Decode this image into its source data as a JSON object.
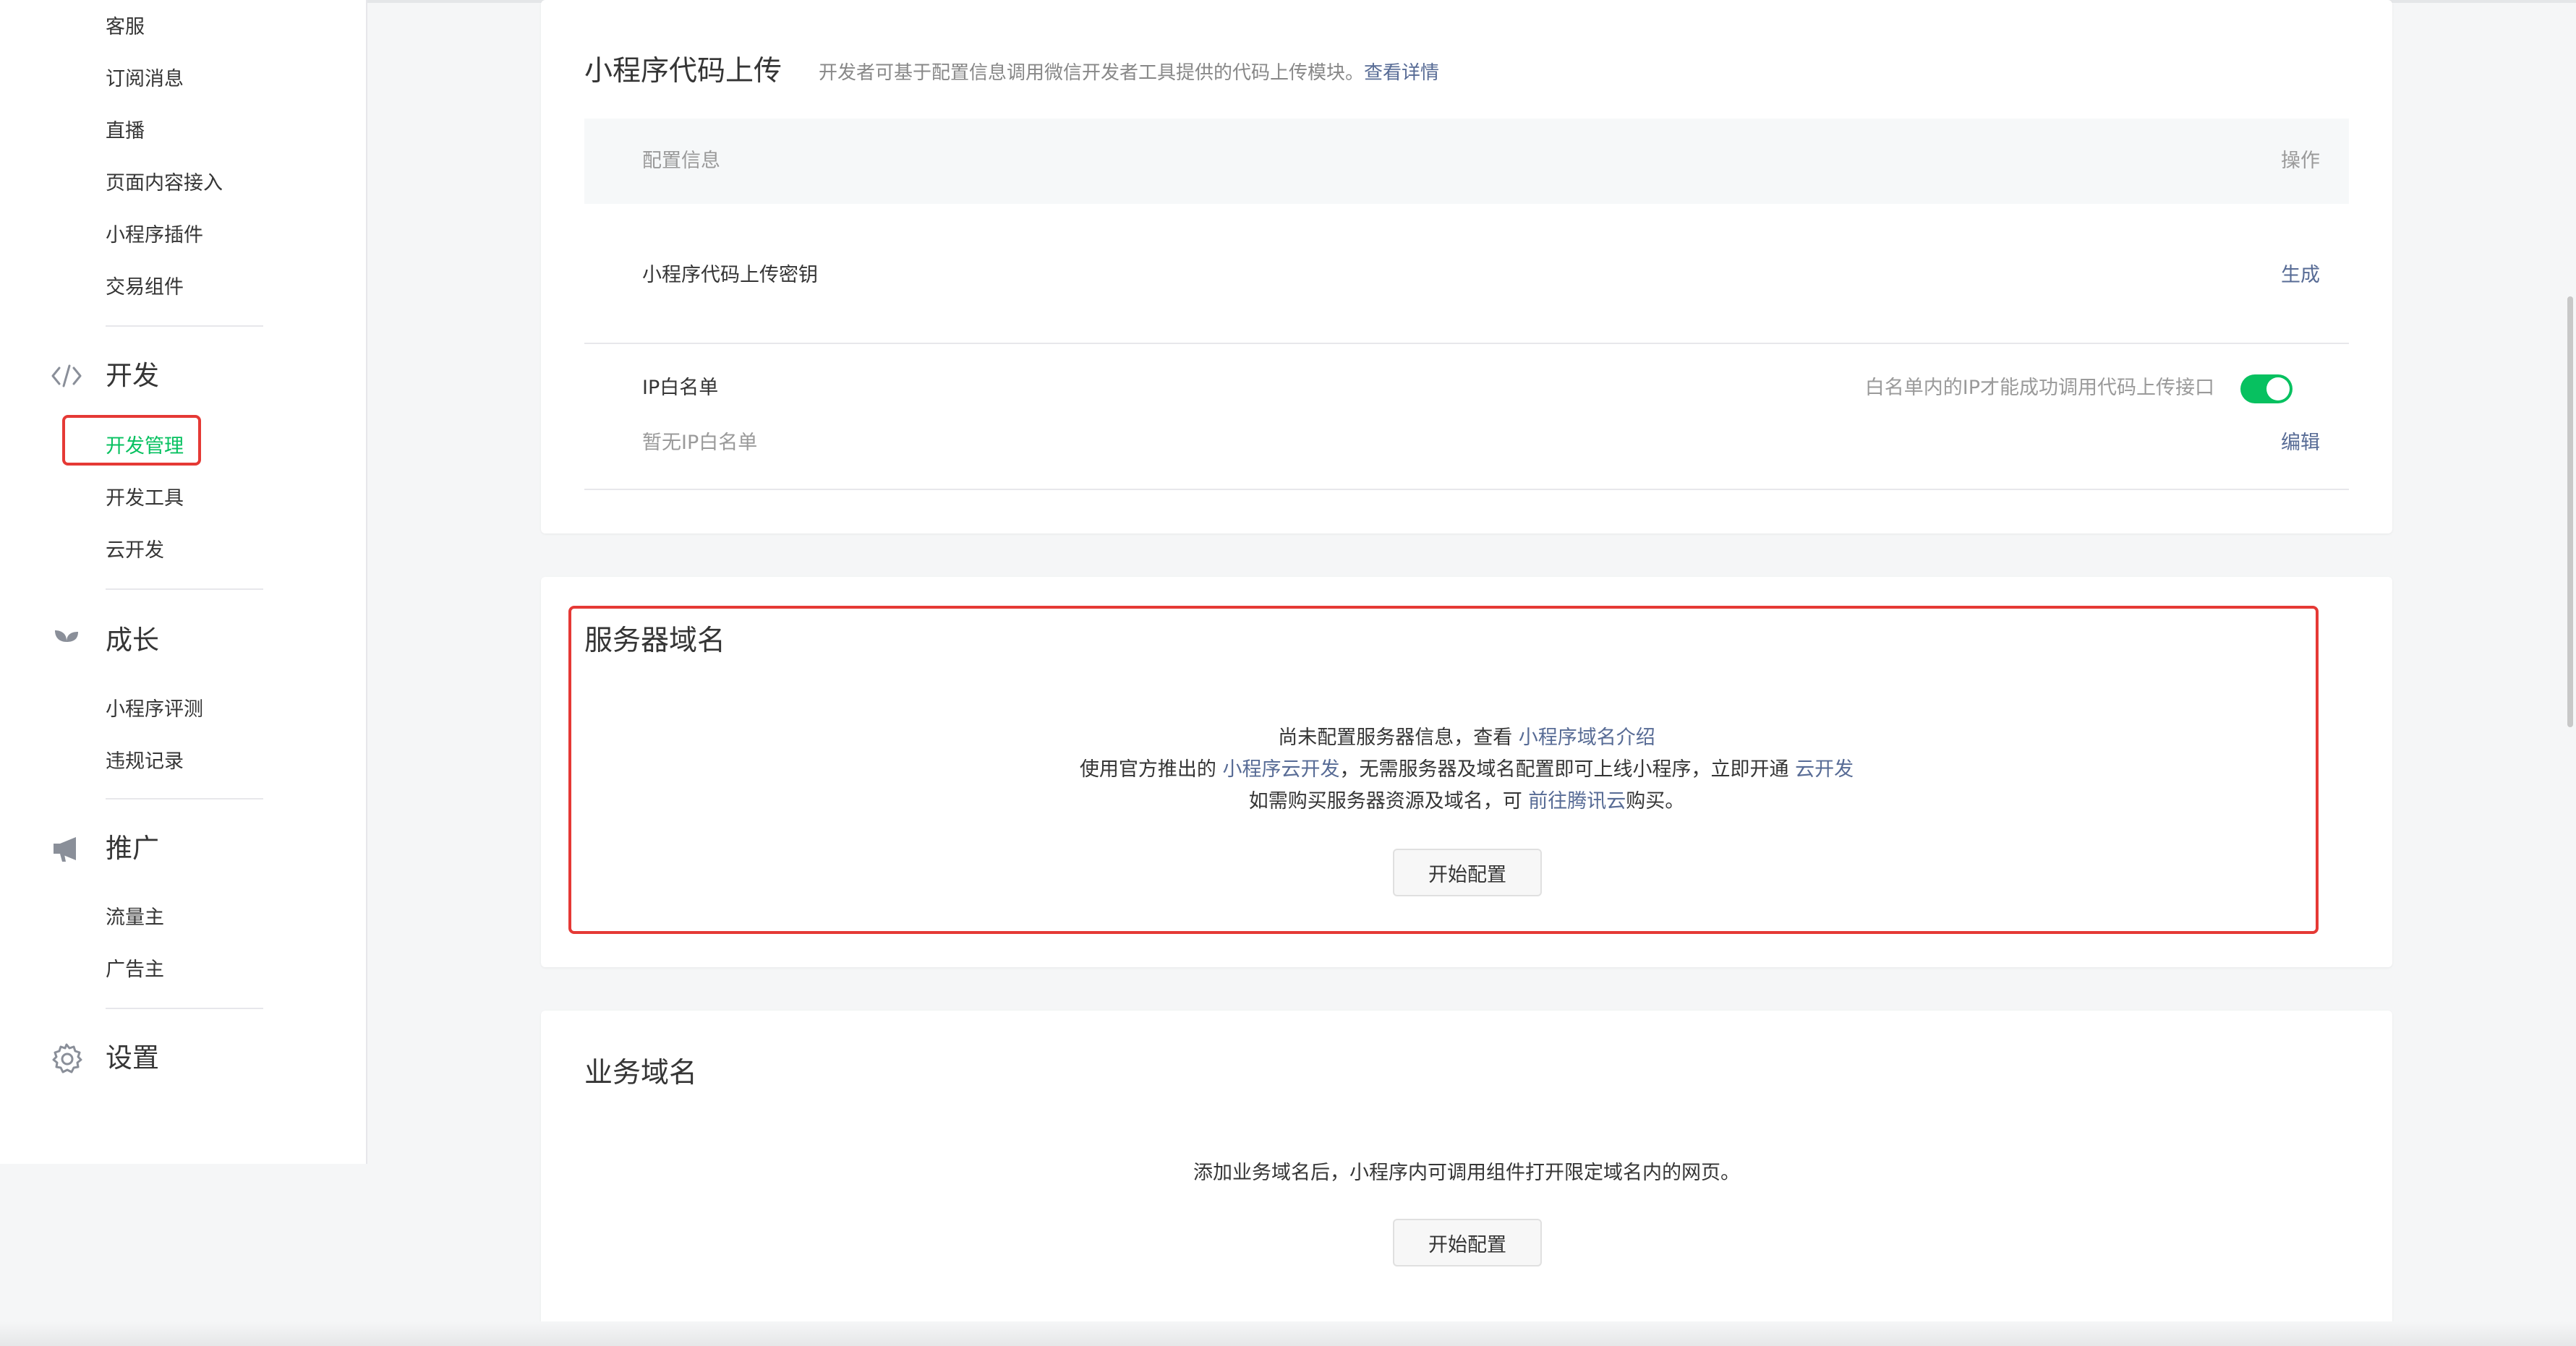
{
  "sidebar": {
    "top_items": [
      "客服",
      "订阅消息",
      "直播",
      "页面内容接入",
      "小程序插件",
      "交易组件"
    ],
    "sections": {
      "dev": {
        "title": "开发",
        "icon": "code-icon",
        "items": [
          "开发管理",
          "开发工具",
          "云开发"
        ],
        "active_item": "开发管理"
      },
      "growth": {
        "title": "成长",
        "icon": "sprout-icon",
        "items": [
          "小程序评测",
          "违规记录"
        ]
      },
      "promo": {
        "title": "推广",
        "icon": "megaphone-icon",
        "items": [
          "流量主",
          "广告主"
        ]
      },
      "settings": {
        "title": "设置",
        "icon": "gear-icon"
      }
    }
  },
  "upload_card": {
    "title": "小程序代码上传",
    "desc": "开发者可基于配置信息调用微信开发者工具提供的代码上传模块。",
    "desc_link": "查看详情",
    "table": {
      "col_config": "配置信息",
      "col_action": "操作",
      "rows": [
        {
          "label": "小程序代码上传密钥",
          "action": "生成"
        },
        {
          "label": "IP白名单",
          "sub": "暂无IP白名单",
          "toggle_label": "白名单内的IP才能成功调用代码上传接口",
          "toggle_on": true,
          "action": "编辑"
        }
      ]
    }
  },
  "server_card": {
    "title": "服务器域名",
    "line1_prefix": "尚未配置服务器信息，查看",
    "line1_link": "小程序域名介绍",
    "line2_prefix": "使用官方推出的",
    "line2_link1": "小程序云开发",
    "line2_mid": "，无需服务器及域名配置即可上线小程序，立即开通",
    "line2_link2": "云开发",
    "line3_prefix": "如需购买服务器资源及域名，可",
    "line3_link": "前往腾讯云",
    "line3_suffix": "购买。",
    "button": "开始配置"
  },
  "business_card": {
    "title": "业务域名",
    "desc": "添加业务域名后，小程序内可调用组件打开限定域名内的网页。",
    "button": "开始配置"
  },
  "colors": {
    "accent_green": "#07c160",
    "link_blue": "#576b95",
    "annotation_red": "#e53935"
  }
}
